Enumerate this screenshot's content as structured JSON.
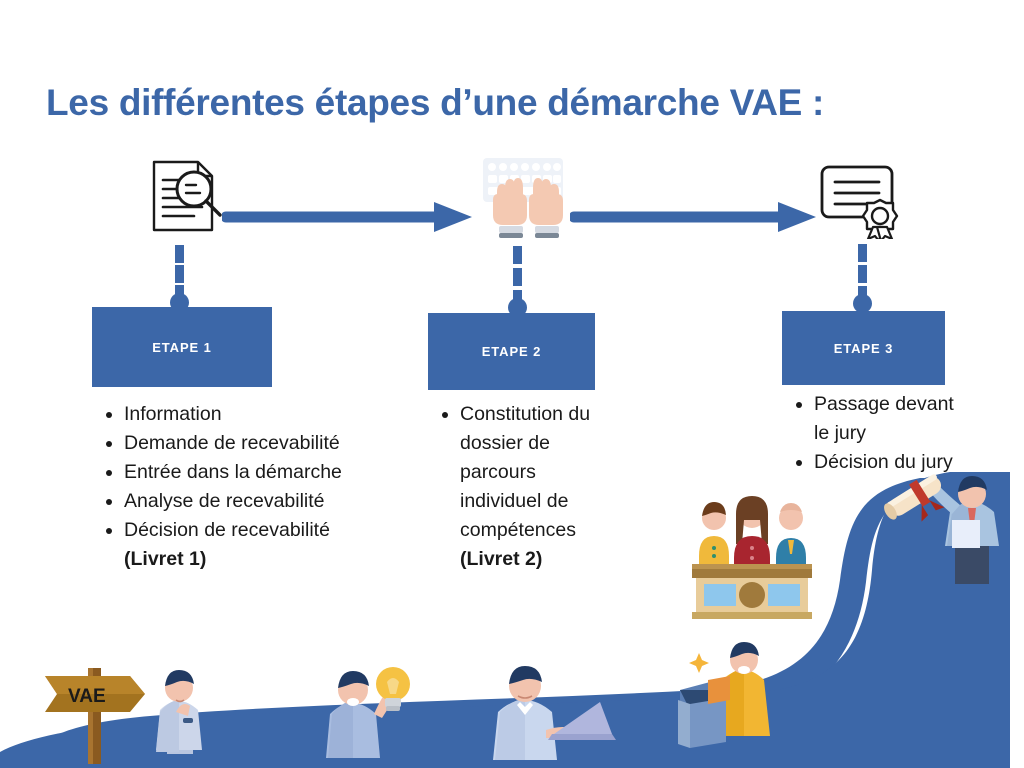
{
  "page": {
    "title": "Les différentes étapes d’une démarche VAE :",
    "accent_color": "#3c67a8",
    "background_color": "#ffffff",
    "text_color": "#1a1a1a"
  },
  "steps": [
    {
      "label": "ETAPE 1",
      "icon": "document-magnifier-icon",
      "bullets": [
        {
          "text": "Information",
          "bold_suffix": ""
        },
        {
          "text": "Demande de recevabilité",
          "bold_suffix": ""
        },
        {
          "text": "Entrée dans la démarche",
          "bold_suffix": ""
        },
        {
          "text": "Analyse de recevabilité",
          "bold_suffix": ""
        },
        {
          "text": "Décision de recevabilité ",
          "bold_suffix": "(Livret 1)"
        }
      ]
    },
    {
      "label": "ETAPE 2",
      "icon": "hands-keyboard-icon",
      "bullets": [
        {
          "text": "Constitution du dossier de parcours individuel de compétences ",
          "bold_suffix": "(Livret 2)"
        }
      ]
    },
    {
      "label": "ETAPE 3",
      "icon": "certificate-icon",
      "bullets": [
        {
          "text": "Passage devant le jury",
          "bold_suffix": ""
        },
        {
          "text": "Décision du jury",
          "bold_suffix": ""
        }
      ]
    }
  ],
  "illustrations": {
    "signpost_label": "VAE",
    "items": [
      {
        "name": "vae-signpost",
        "description": "wooden directional signpost reading VAE"
      },
      {
        "name": "person-thinking",
        "description": "person in light blue shirt thinking"
      },
      {
        "name": "person-idea-lightbulb",
        "description": "person holding a yellow lightbulb"
      },
      {
        "name": "person-laptop",
        "description": "person working on a laptop"
      },
      {
        "name": "person-archive-box",
        "description": "person in yellow opening a box with an orange folder"
      },
      {
        "name": "jury-panel",
        "description": "three jury members seated behind a wooden desk"
      },
      {
        "name": "person-diploma",
        "description": "person raising a rolled diploma with red ribbon"
      },
      {
        "name": "winding-road",
        "description": "blue winding road rising to the right"
      }
    ]
  },
  "connectors": {
    "arrow_1_2": "arrow pointing right from step 1 to step 2",
    "arrow_2_3": "arrow pointing right from step 2 to step 3"
  }
}
